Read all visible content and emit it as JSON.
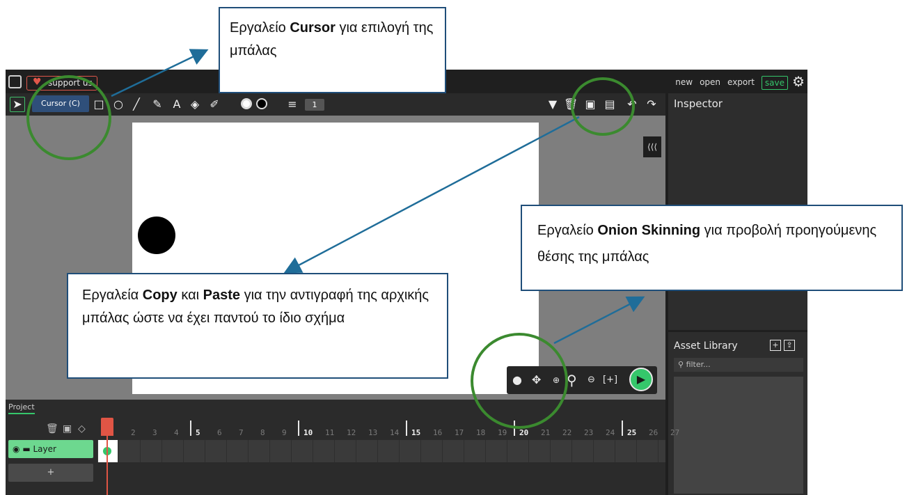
{
  "topbar": {
    "support_label": "support us",
    "menu": {
      "new": "new",
      "open": "open",
      "export": "export",
      "save": "save"
    }
  },
  "toolbar": {
    "tooltip": "Cursor (C)",
    "line_width": "1"
  },
  "inspector": {
    "title": "Inspector"
  },
  "asset_library": {
    "title": "Asset Library",
    "filter_placeholder": "filter..."
  },
  "timeline": {
    "tab": "Project",
    "frames": [
      "2",
      "3",
      "4",
      "5",
      "6",
      "7",
      "8",
      "9",
      "10",
      "11",
      "12",
      "13",
      "14",
      "15",
      "16",
      "17",
      "18",
      "19",
      "20",
      "21",
      "22",
      "23",
      "24",
      "25",
      "26",
      "27"
    ],
    "layer_name": "Layer",
    "add_layer": "+"
  },
  "callouts": {
    "cursor": {
      "prefix": "Εργαλείο ",
      "bold": "Cursor",
      "suffix": " για επιλογή της μπάλας"
    },
    "copy_paste": {
      "prefix": "Εργαλεία ",
      "bold1": "Copy",
      "middle": " και ",
      "bold2": "Paste",
      "suffix": " για την αντιγραφή της αρχικής μπάλας ώστε να έχει παντού το ίδιο σχήμα"
    },
    "onion": {
      "prefix": "Εργαλείο ",
      "bold": "Onion Skinning",
      "suffix": " για προβολή προηγούμενης θέσης της μπάλας"
    }
  },
  "colors": {
    "accent": "#35c76b",
    "support": "#e0574a",
    "annotation_border": "#1f4e79",
    "highlight_circle": "#3b8a2f"
  }
}
